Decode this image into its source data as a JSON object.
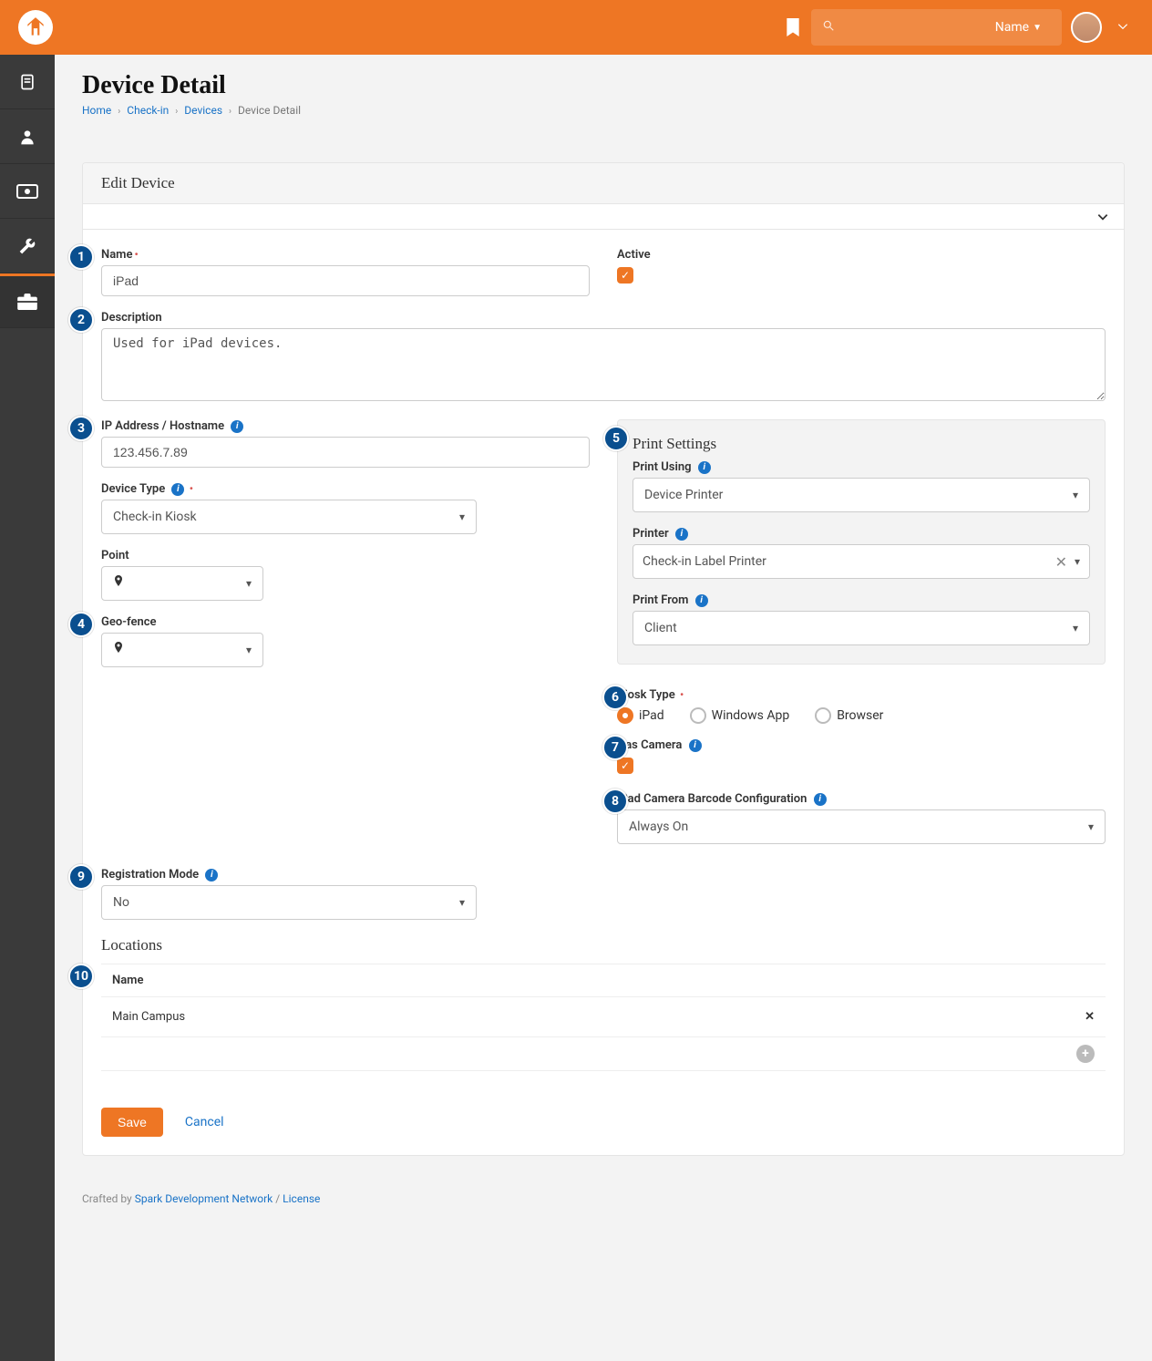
{
  "topbar": {
    "name_menu": "Name"
  },
  "page": {
    "title": "Device Detail",
    "breadcrumb": {
      "home": "Home",
      "checkin": "Check-in",
      "devices": "Devices",
      "current": "Device Detail"
    }
  },
  "panel": {
    "header": "Edit Device",
    "name": {
      "label": "Name",
      "value": "iPad"
    },
    "active": {
      "label": "Active"
    },
    "description": {
      "label": "Description",
      "value": "Used for iPad devices."
    },
    "ip": {
      "label": "IP Address / Hostname",
      "value": "123.456.7.89"
    },
    "device_type": {
      "label": "Device Type",
      "value": "Check-in Kiosk"
    },
    "point": {
      "label": "Point"
    },
    "geofence": {
      "label": "Geo-fence"
    },
    "print_settings": {
      "title": "Print Settings",
      "print_using": {
        "label": "Print Using",
        "value": "Device Printer"
      },
      "printer": {
        "label": "Printer",
        "value": "Check-in Label Printer"
      },
      "print_from": {
        "label": "Print From",
        "value": "Client"
      }
    },
    "kiosk_type": {
      "label": "Kiosk Type",
      "options": {
        "ipad": "iPad",
        "windows": "Windows App",
        "browser": "Browser"
      }
    },
    "has_camera": {
      "label": "Has Camera"
    },
    "barcode": {
      "label": "iPad Camera Barcode Configuration",
      "value": "Always On"
    },
    "reg_mode": {
      "label": "Registration Mode",
      "value": "No"
    },
    "locations": {
      "title": "Locations",
      "col_name": "Name",
      "rows": [
        {
          "name": "Main Campus"
        }
      ]
    },
    "buttons": {
      "save": "Save",
      "cancel": "Cancel"
    }
  },
  "footer": {
    "crafted_by": "Crafted by ",
    "spark": "Spark Development Network",
    "sep": " / ",
    "license": "License"
  },
  "callouts": {
    "c1": "1",
    "c2": "2",
    "c3": "3",
    "c4": "4",
    "c5": "5",
    "c6": "6",
    "c7": "7",
    "c8": "8",
    "c9": "9",
    "c10": "10"
  }
}
